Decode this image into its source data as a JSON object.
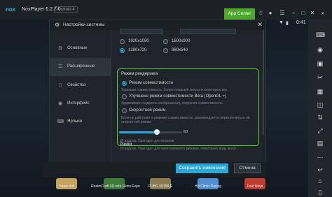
{
  "titlebar": {
    "logo": "nox",
    "app_name": "NoxPlayer 6.2.7.0",
    "android_badge": "Android 4",
    "app_center": "App Center"
  },
  "statusbar": {
    "time": "0:41"
  },
  "dialog": {
    "title": "Настройки системы",
    "nav": [
      {
        "label": "Основные",
        "icon": "gear-icon"
      },
      {
        "label": "Расширенные",
        "icon": "sliders-icon"
      },
      {
        "label": "Свойства",
        "icon": "phone-icon"
      },
      {
        "label": "Интерфейс",
        "icon": "palette-icon"
      },
      {
        "label": "Ярлыки",
        "icon": "keyboard-icon"
      }
    ],
    "active_nav": "Расширенные",
    "resolutions": [
      "1920x1080",
      "1600x900",
      "1280x720",
      "960x540"
    ],
    "selected_resolution": "1280x720",
    "render": {
      "title": "Режим рендеринга",
      "options": [
        {
          "label": "Режим совместимости",
          "hint": "Хорошая совместимость, более плавный запуск в некоторых игр"
        },
        {
          "label": "Улучшенн режим совместимости Beta (OpenGL +)",
          "hint": "Удерживает гладкость изображения, сохраняя совместимость"
        },
        {
          "label": "Скоростной режим",
          "hint": "Если не работают в режиме совместимости, рекомендуется переключиться на скоростной режим"
        }
      ],
      "selected": "Режим совместимости"
    },
    "frames": {
      "title": "Рамки",
      "value": "60",
      "fraction": 0.6,
      "hints": [
        "60 кадров: Пригоден для игроков",
        "20 кадров: Пригоден для многооконного режима, некоторые игры могут..."
      ]
    },
    "save_button": "Сохранить изменения",
    "cancel_button": "Отмена"
  },
  "apps": [
    {
      "label": "Toppo doll",
      "color": "#c9a25a"
    },
    {
      "label": "RealmCraft 3D with Skins Expo",
      "color": "#3e7a3a"
    },
    {
      "label": "PUBG MOBILE",
      "color": "#8a7a4e"
    },
    {
      "label": "Hill Climb Racing",
      "color": "#4e8fd2"
    },
    {
      "label": "Fruit Ninja",
      "color": "#c23a2a"
    }
  ],
  "colors": {
    "accent": "#2ea8e0",
    "highlight": "#52d62b",
    "app_center": "#4ca82a"
  }
}
